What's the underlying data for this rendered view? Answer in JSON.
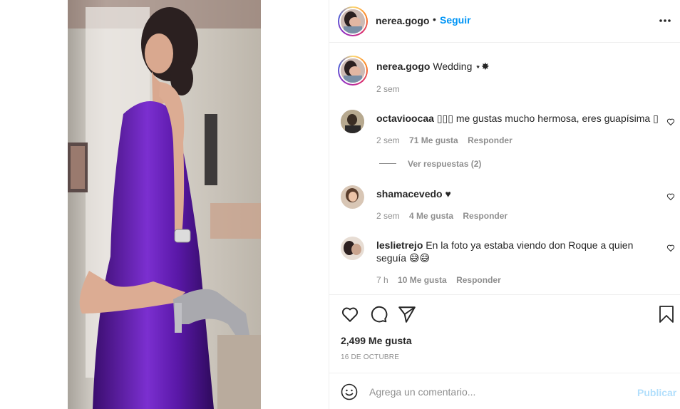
{
  "post": {
    "author": "nerea.gogo",
    "follow_label": "Seguir",
    "dot": "•",
    "more_label": "•••"
  },
  "caption": {
    "username": "nerea.gogo",
    "text": "Wedding ⋆✸",
    "age": "2 sem"
  },
  "comments": [
    {
      "username": "octavioocaa",
      "text": "▯▯▯ me gustas mucho hermosa, eres guapísima ▯",
      "age": "2 sem",
      "likes": "71 Me gusta",
      "reply": "Responder",
      "view_replies": "Ver respuestas (2)"
    },
    {
      "username": "shamacevedo",
      "text": "♥",
      "age": "2 sem",
      "likes": "4 Me gusta",
      "reply": "Responder"
    },
    {
      "username": "leslietrejo",
      "text_line1": "En la foto ya estaba viendo don Roque a quien",
      "text_line2": "seguía 😅😅",
      "age": "7 h",
      "likes": "10 Me gusta",
      "reply": "Responder"
    }
  ],
  "actions": {
    "like_icon": "heart-icon",
    "comment_icon": "comment-icon",
    "share_icon": "share-icon",
    "save_icon": "bookmark-icon",
    "likes_count": "2,499 Me gusta",
    "date": "16 DE OCTUBRE"
  },
  "add_comment": {
    "placeholder": "Agrega un comentario...",
    "publish_label": "Publicar",
    "emoji_icon": "emoji-icon"
  },
  "colors": {
    "accent": "#0095f6",
    "publish_disabled": "#b2dffc",
    "dress": "#6a1fb0"
  }
}
